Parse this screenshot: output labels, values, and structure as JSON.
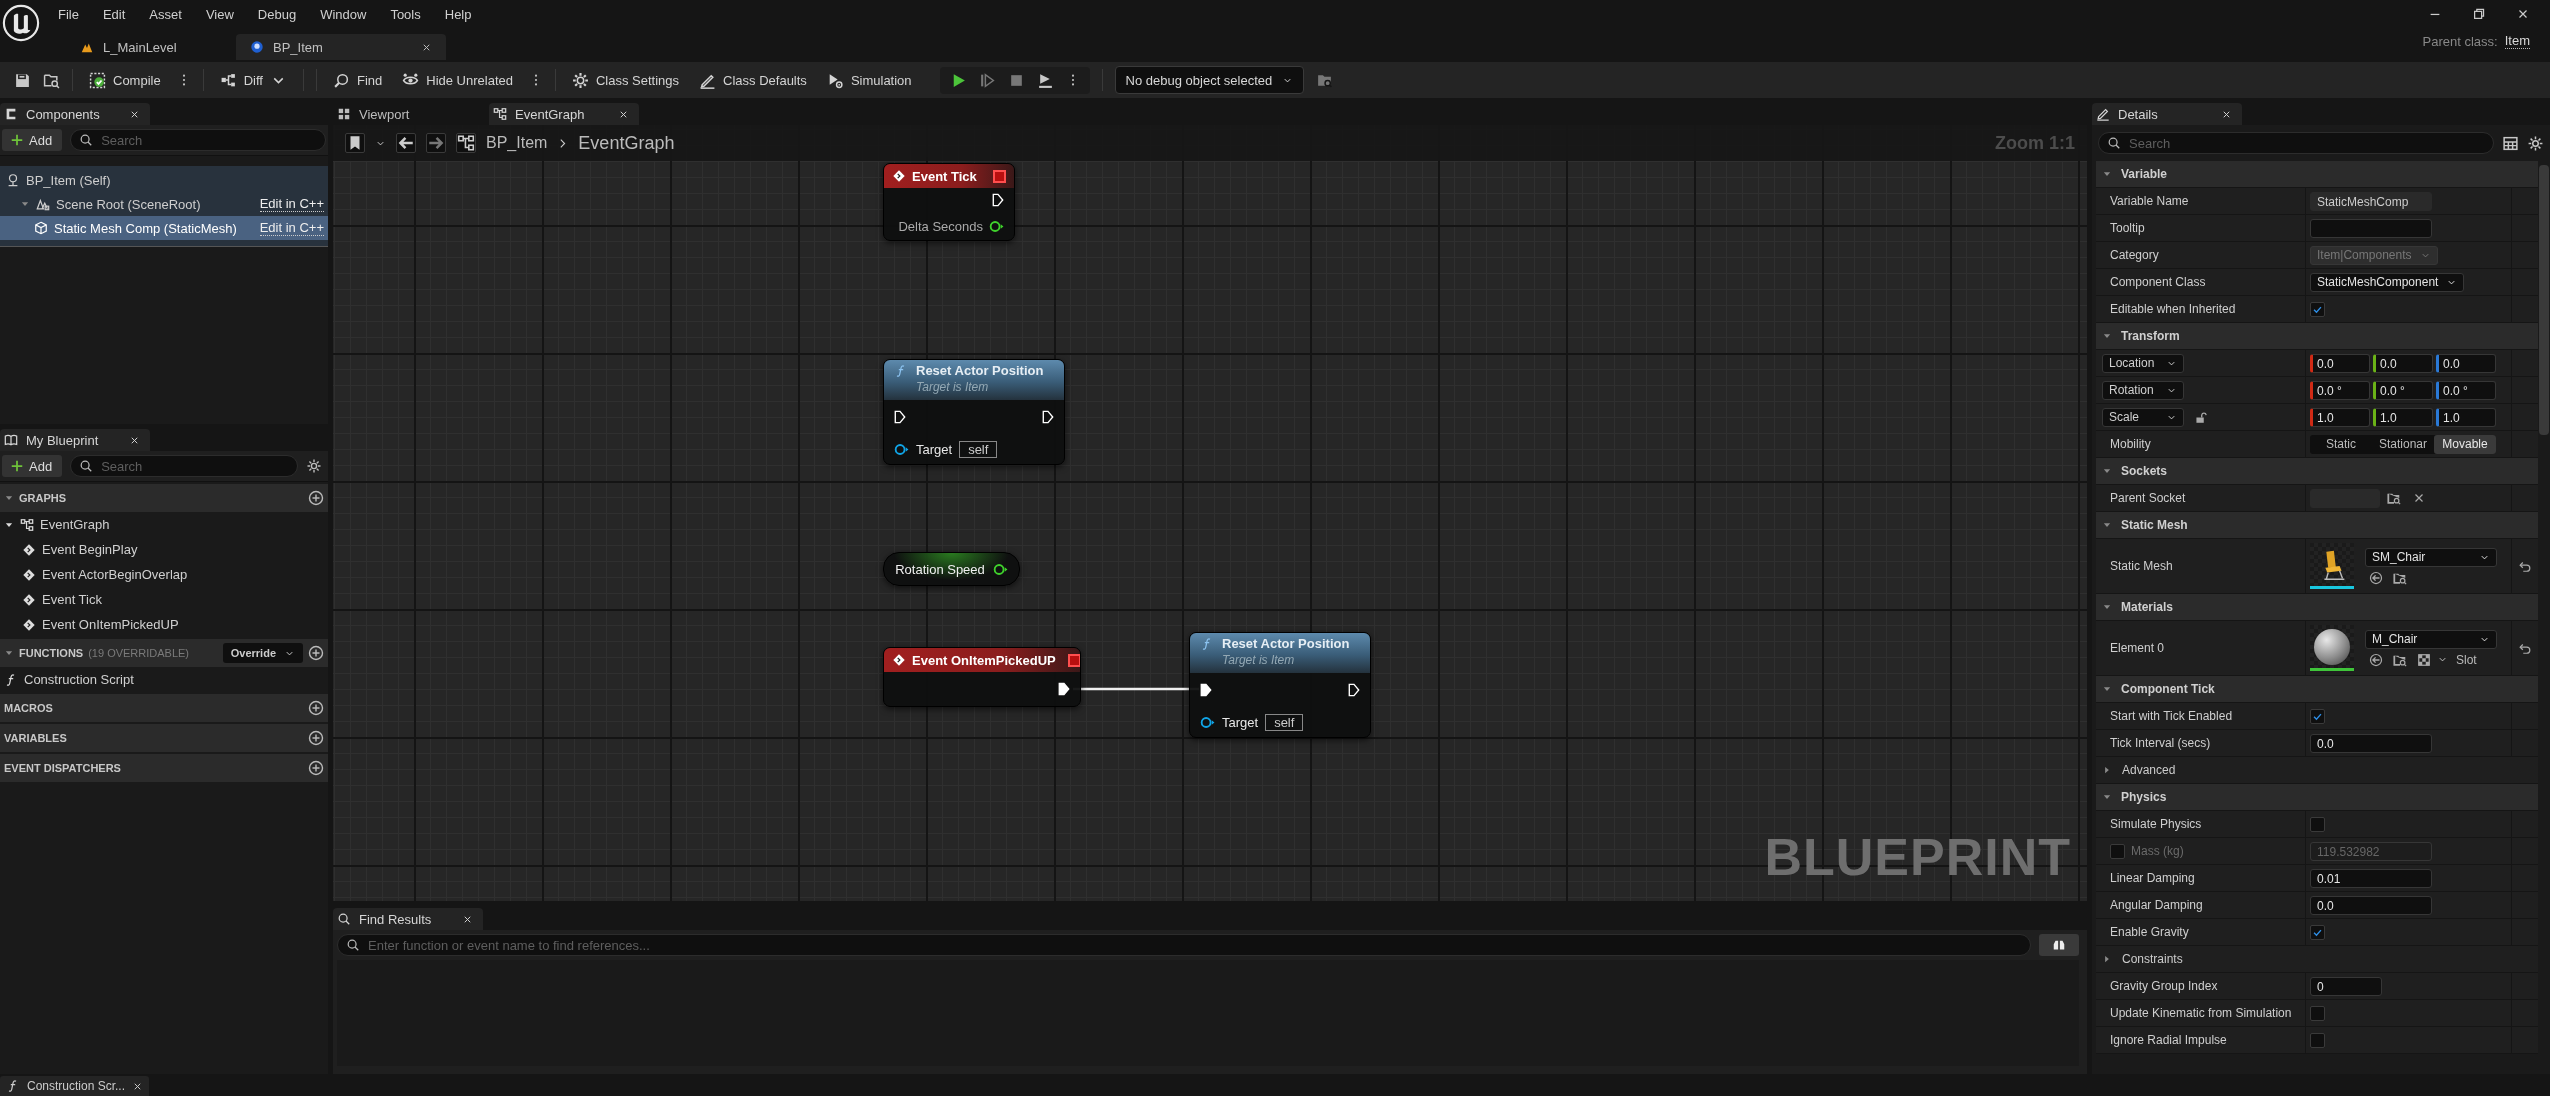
{
  "menu": [
    "File",
    "Edit",
    "Asset",
    "View",
    "Debug",
    "Window",
    "Tools",
    "Help"
  ],
  "document_tabs": [
    {
      "label": "L_MainLevel",
      "kind": "level",
      "selected": false
    },
    {
      "label": "BP_Item",
      "kind": "blueprint",
      "selected": true
    }
  ],
  "parent_class": {
    "label": "Parent class:",
    "value": "Item"
  },
  "toolbar": [
    {
      "kind": "compile",
      "label": "Compile"
    },
    {
      "kind": "diff",
      "label": "Diff"
    },
    {
      "kind": "find",
      "label": "Find"
    },
    {
      "kind": "hide_unrelated",
      "label": "Hide Unrelated"
    },
    {
      "kind": "class_settings",
      "label": "Class Settings"
    },
    {
      "kind": "class_defaults",
      "label": "Class Defaults"
    },
    {
      "kind": "simulation",
      "label": "Simulation"
    }
  ],
  "debug_filter": "No debug object selected",
  "components": {
    "title": "Components",
    "add_label": "Add",
    "search_placeholder": "Search",
    "tree": [
      {
        "label": "BP_Item (Self)",
        "kind": "actor",
        "selected": false,
        "children": [
          {
            "label": "Scene Root (SceneRoot)",
            "kind": "scene",
            "selected": false,
            "expanded": true,
            "link": "Edit in C++",
            "children": [
              {
                "label": "Static Mesh Comp (StaticMesh)",
                "kind": "mesh",
                "selected": true,
                "link": "Edit in C++"
              }
            ]
          }
        ]
      }
    ]
  },
  "my_blueprint": {
    "title": "My Blueprint",
    "add_label": "Add",
    "search_placeholder": "Search",
    "sections": [
      {
        "title": "GRAPHS",
        "items": [
          {
            "label": "EventGraph",
            "kind": "graph",
            "expanded": true,
            "children": [
              {
                "label": "Event BeginPlay",
                "kind": "event"
              },
              {
                "label": "Event ActorBeginOverlap",
                "kind": "event"
              },
              {
                "label": "Event Tick",
                "kind": "event"
              },
              {
                "label": "Event OnItemPickedUP",
                "kind": "event"
              }
            ]
          }
        ]
      },
      {
        "title": "FUNCTIONS",
        "note": "(19 OVERRIDABLE)",
        "dropdown": "Override",
        "items": [
          {
            "label": "Construction Script",
            "kind": "function"
          }
        ]
      },
      {
        "title": "MACROS"
      },
      {
        "title": "VARIABLES"
      },
      {
        "title": "EVENT DISPATCHERS"
      }
    ]
  },
  "graph": {
    "tabs": [
      {
        "label": "Viewport",
        "kind": "viewport",
        "selected": false
      },
      {
        "label": "EventGraph",
        "kind": "graph",
        "selected": true
      }
    ],
    "breadcrumb": [
      "BP_Item",
      "EventGraph"
    ],
    "zoom": "Zoom 1:1",
    "type_label": "BLUEPRINT",
    "nodes": [
      {
        "kind": "event",
        "title": "Event Tick",
        "exec_out_connected": false,
        "output": {
          "label": "Delta Seconds",
          "color": "#3fd12c"
        }
      },
      {
        "kind": "function",
        "title": "Reset Actor Position",
        "subtitle": "Target is Item",
        "exec_in_connected": false,
        "exec_out_connected": false,
        "target": {
          "label": "Target",
          "value": "self",
          "color": "#10a4e6"
        }
      },
      {
        "kind": "variable",
        "title": "Rotation Speed",
        "color": "#3fd12c"
      },
      {
        "kind": "event",
        "title": "Event OnItemPickedUP",
        "exec_out_connected": true
      },
      {
        "kind": "function",
        "title": "Reset Actor Position",
        "subtitle": "Target is Item",
        "exec_in_connected": true,
        "exec_out_connected": false,
        "target": {
          "label": "Target",
          "value": "self",
          "color": "#10a4e6"
        }
      }
    ]
  },
  "find_results": {
    "title": "Find Results",
    "placeholder": "Enter function or event name to find references..."
  },
  "details": {
    "title": "Details",
    "search_placeholder": "Search",
    "sections": [
      {
        "title": "Variable",
        "expanded": true,
        "rows": [
          {
            "kind": "text",
            "label": "Variable Name",
            "value": "StaticMeshComp"
          },
          {
            "kind": "text",
            "label": "Tooltip"
          },
          {
            "kind": "dropdown",
            "label": "Category",
            "value": "Item|Components",
            "disabled": true
          },
          {
            "kind": "dropdown",
            "label": "Component Class",
            "value": "StaticMeshComponent",
            "disabled": false
          },
          {
            "kind": "checkbox",
            "label": "Editable when Inherited",
            "checked": true
          }
        ]
      },
      {
        "title": "Transform",
        "expanded": true,
        "rows": [
          {
            "kind": "vector",
            "label": "Location",
            "values": [
              "0.0",
              "0.0",
              "0.0"
            ]
          },
          {
            "kind": "vector",
            "label": "Rotation",
            "values": [
              "0.0 °",
              "0.0 °",
              "0.0 °"
            ]
          },
          {
            "kind": "vector",
            "label": "Scale",
            "values": [
              "1.0",
              "1.0",
              "1.0"
            ],
            "ratio_locked": false
          },
          {
            "kind": "segmented",
            "label": "Mobility",
            "options": [
              {
                "label": "Static",
                "selected": false
              },
              {
                "label": "Stationar",
                "selected": false
              },
              {
                "label": "Movable",
                "selected": true
              }
            ]
          }
        ]
      },
      {
        "title": "Sockets",
        "expanded": true,
        "rows": [
          {
            "kind": "socket",
            "label": "Parent Socket"
          }
        ]
      },
      {
        "title": "Static Mesh",
        "expanded": true,
        "rows": [
          {
            "kind": "mesh_asset",
            "label": "Static Mesh",
            "value": "SM_Chair"
          }
        ]
      },
      {
        "title": "Materials",
        "expanded": true,
        "rows": [
          {
            "kind": "material_asset",
            "label": "Element 0",
            "value": "M_Chair",
            "slot": "Slot"
          }
        ]
      },
      {
        "title": "Component Tick",
        "expanded": true,
        "rows": [
          {
            "kind": "checkbox",
            "label": "Start with Tick Enabled",
            "checked": true
          },
          {
            "kind": "text",
            "label": "Tick Interval (secs)",
            "value": "0.0"
          },
          {
            "kind": "group",
            "label": "Advanced",
            "expanded": false
          }
        ]
      },
      {
        "title": "Physics",
        "expanded": true,
        "rows": [
          {
            "kind": "checkbox",
            "label": "Simulate Physics",
            "checked": false
          },
          {
            "kind": "override",
            "label": "Mass (kg)",
            "checked": false,
            "value": "119.532982",
            "disabled": true
          },
          {
            "kind": "text",
            "label": "Linear Damping",
            "value": "0.01"
          },
          {
            "kind": "text",
            "label": "Angular Damping",
            "value": "0.0"
          },
          {
            "kind": "checkbox",
            "label": "Enable Gravity",
            "checked": true
          },
          {
            "kind": "group",
            "label": "Constraints",
            "expanded": false
          },
          {
            "kind": "short_text",
            "label": "Gravity Group Index",
            "value": "0"
          },
          {
            "kind": "checkbox",
            "label": "Update Kinematic from Simulation",
            "checked": false
          },
          {
            "kind": "checkbox",
            "label": "Ignore Radial Impulse",
            "checked": false
          }
        ]
      }
    ]
  },
  "bottom_tab": {
    "label": "Construction Scr..."
  }
}
